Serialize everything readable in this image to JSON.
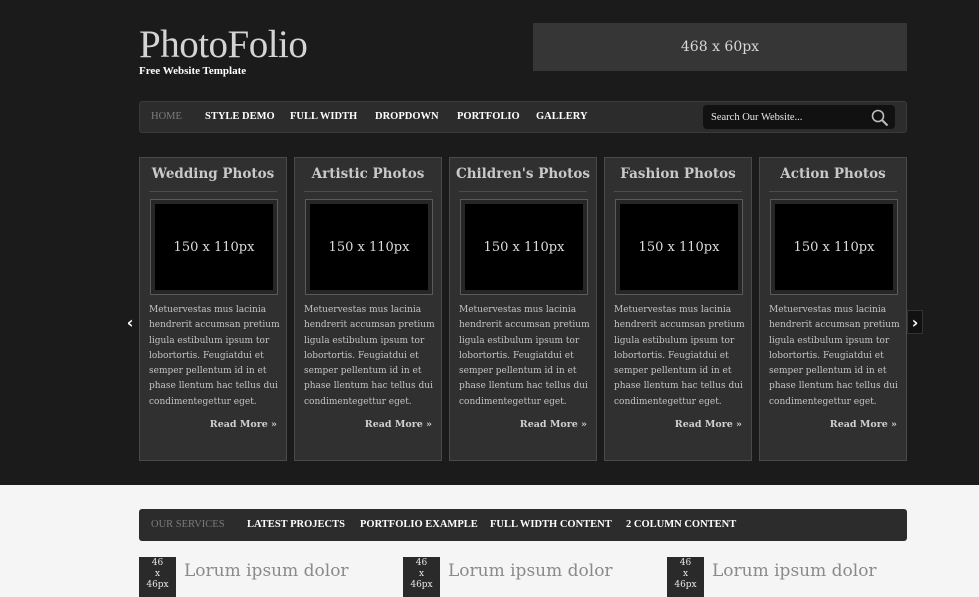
{
  "header": {
    "logo": "PhotoFolio",
    "tagline": "Free Website Template",
    "banner": "468 x 60px"
  },
  "nav": {
    "items": [
      "HOME",
      "STYLE DEMO",
      "FULL WIDTH",
      "DROPDOWN",
      "PORTFOLIO",
      "GALLERY"
    ]
  },
  "search": {
    "placeholder": "Search Our Website..."
  },
  "carousel": {
    "cards": [
      {
        "title": "Wedding Photos",
        "thumb": "150 x 110px",
        "text": "Metuervestas mus lacinia hendrerit accumsan pretium ligula estibulum ipsum tor lobortortis. Feugiatdui et semper pellentum id in et phase llentum hac tellus dui condimentegettur eget.",
        "more": "Read More »"
      },
      {
        "title": "Artistic Photos",
        "thumb": "150 x 110px",
        "text": "Metuervestas mus lacinia hendrerit accumsan pretium ligula estibulum ipsum tor lobortortis. Feugiatdui et semper pellentum id in et phase llentum hac tellus dui condimentegettur eget.",
        "more": "Read More »"
      },
      {
        "title": "Children's Photos",
        "thumb": "150 x 110px",
        "text": "Metuervestas mus lacinia hendrerit accumsan pretium ligula estibulum ipsum tor lobortortis. Feugiatdui et semper pellentum id in et phase llentum hac tellus dui condimentegettur eget.",
        "more": "Read More »"
      },
      {
        "title": "Fashion Photos",
        "thumb": "150 x 110px",
        "text": "Metuervestas mus lacinia hendrerit accumsan pretium ligula estibulum ipsum tor lobortortis. Feugiatdui et semper pellentum id in et phase llentum hac tellus dui condimentegettur eget.",
        "more": "Read More »"
      },
      {
        "title": "Action Photos",
        "thumb": "150 x 110px",
        "text": "Metuervestas mus lacinia hendrerit accumsan pretium ligula estibulum ipsum tor lobortortis. Feugiatdui et semper pellentum id in et phase llentum hac tellus dui condimentegettur eget.",
        "more": "Read More »"
      }
    ],
    "prev": "‹",
    "next": "›"
  },
  "tabs": {
    "items": [
      "OUR SERVICES",
      "LATEST PROJECTS",
      "PORTFOLIO EXAMPLE",
      "FULL WIDTH CONTENT",
      "2 COLUMN CONTENT"
    ]
  },
  "services": [
    {
      "thumb": "46\nx\n46px",
      "title": "Lorum ipsum dolor"
    },
    {
      "thumb": "46\nx\n46px",
      "title": "Lorum ipsum dolor"
    },
    {
      "thumb": "46\nx\n46px",
      "title": "Lorum ipsum dolor"
    }
  ]
}
